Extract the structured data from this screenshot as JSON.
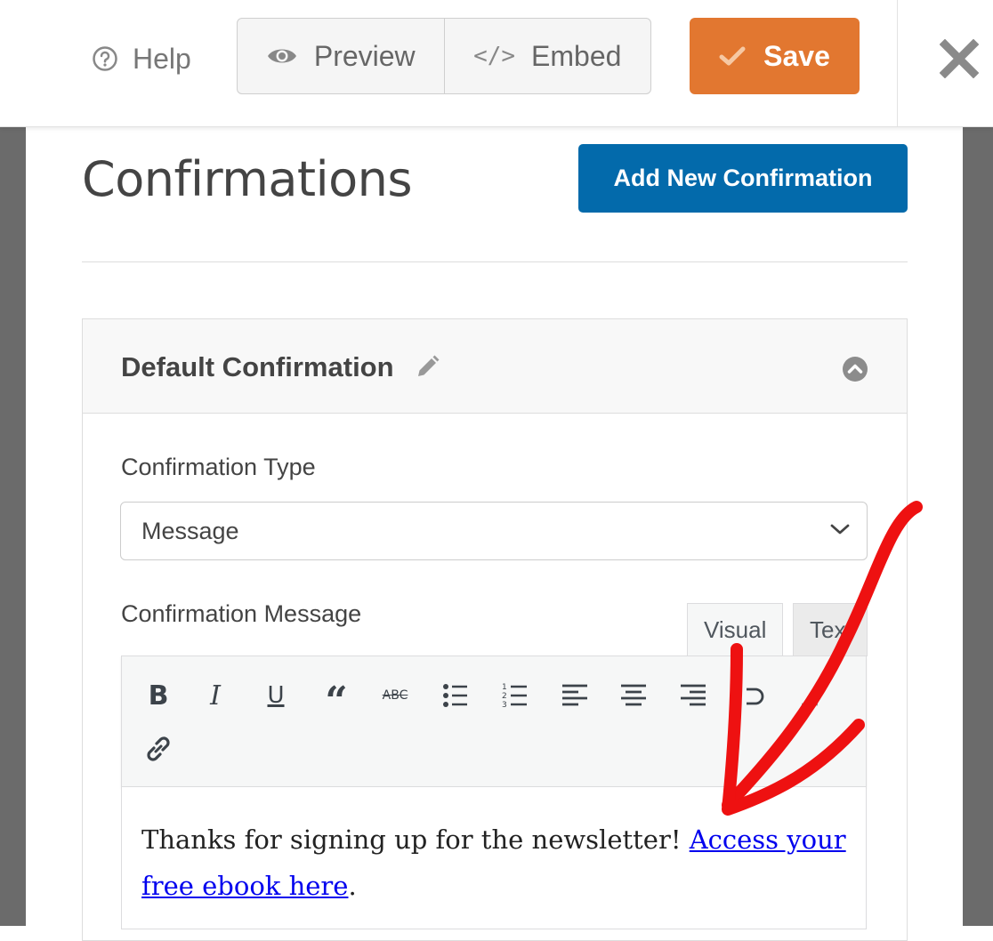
{
  "toolbar": {
    "help_label": "Help",
    "preview_label": "Preview",
    "embed_label": "Embed",
    "save_label": "Save"
  },
  "page": {
    "title": "Confirmations",
    "add_button_label": "Add New Confirmation"
  },
  "confirmation": {
    "name": "Default Confirmation",
    "type_label": "Confirmation Type",
    "type_value": "Message",
    "message_label": "Confirmation Message",
    "tabs": [
      "Visual",
      "Text"
    ],
    "message_text": "Thanks for signing up for the newsletter! ",
    "link_text": "Access your free ebook here",
    "message_suffix": "."
  },
  "icons": {
    "help": "question-circle-icon",
    "preview": "eye-icon",
    "embed": "code-icon",
    "save": "check-icon",
    "close": "close-icon",
    "edit": "pencil-icon",
    "collapse": "chevron-up-circle-icon",
    "editor": [
      "bold-icon",
      "italic-icon",
      "underline-icon",
      "blockquote-icon",
      "strikethrough-icon",
      "bullet-list-icon",
      "numbered-list-icon",
      "align-left-icon",
      "align-center-icon",
      "align-right-icon",
      "undo-icon",
      "redo-icon",
      "link-icon"
    ]
  },
  "colors": {
    "save": "#e27730",
    "primary_button": "#036aab",
    "annotation_arrow": "#ee1111",
    "link": "#0000ee"
  }
}
